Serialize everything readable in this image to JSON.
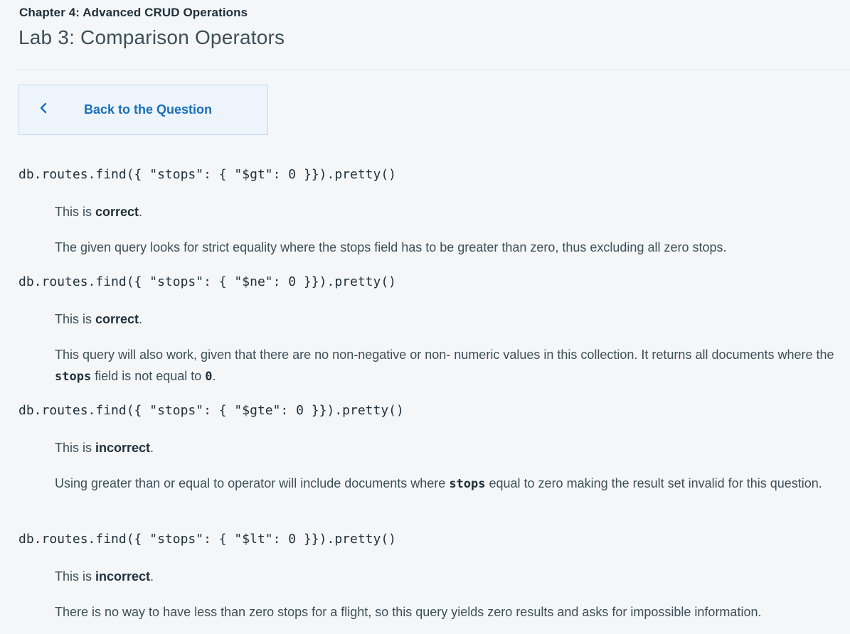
{
  "header": {
    "chapter": "Chapter 4: Advanced CRUD Operations",
    "lab_title": "Lab 3: Comparison Operators"
  },
  "back_button": {
    "icon": "chevron-left-icon",
    "label": "Back to the Question"
  },
  "answers": [
    {
      "code": "db.routes.find({ \"stops\": { \"$gt\": 0 }}).pretty()",
      "verdict_prefix": "This is ",
      "verdict": "correct",
      "verdict_suffix": ".",
      "explanation": "The given query looks for strict equality where the stops field has to be greater than zero, thus excluding all zero stops."
    },
    {
      "code": "db.routes.find({ \"stops\": { \"$ne\": 0 }}).pretty()",
      "verdict_prefix": "This is ",
      "verdict": "correct",
      "verdict_suffix": ".",
      "explanation_parts": {
        "part1": "This query will also work, given that there are no non-negative or non- numeric values in this collection. It returns all documents where the ",
        "code1": "stops",
        "part2": " field is not equal to ",
        "code2": "0",
        "part3": "."
      }
    },
    {
      "code": "db.routes.find({ \"stops\": { \"$gte\": 0 }}).pretty()",
      "verdict_prefix": "This is ",
      "verdict": "incorrect",
      "verdict_suffix": ".",
      "explanation_parts": {
        "part1": "Using greater than or equal to operator will include documents where ",
        "code1": "stops",
        "part2": " equal to zero making the result set invalid for this question."
      }
    },
    {
      "code": "db.routes.find({ \"stops\": { \"$lt\": 0 }}).pretty()",
      "verdict_prefix": "This is ",
      "verdict": "incorrect",
      "verdict_suffix": ".",
      "explanation": "There is no way to have less than zero stops for a flight, so this query yields zero results and asks for impossible information."
    }
  ],
  "colors": {
    "background": "#f4f6f8",
    "accent": "#1a6fba",
    "text": "#3d4f58"
  }
}
